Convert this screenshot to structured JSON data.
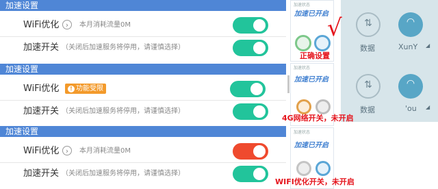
{
  "sections": [
    {
      "header": "加速设置",
      "wifi_label": "WiFi优化",
      "wifi_sub": "本月消耗流量0M",
      "accel_label": "加速开关",
      "accel_sub": "（关闭后加速服务将停用，请谨慎选择）"
    },
    {
      "header": "加速设置",
      "wifi_label": "WiFi优化",
      "wifi_badge": "功能受限",
      "accel_label": "加速开关",
      "accel_sub": "（关闭后加速服务将停用，请谨慎选择）"
    },
    {
      "header": "加速设置",
      "wifi_label": "WiFi优化",
      "wifi_sub": "本月消耗流量0M",
      "accel_label": "加速开关",
      "accel_sub": "（关闭后加速服务将停用，请谨慎选择）"
    }
  ],
  "toggles": {
    "s1_wifi": "on",
    "s1_accel": "on",
    "s2_wifi": "on",
    "s2_accel": "on",
    "s3_wifi": "off",
    "s3_accel": "on"
  },
  "panels": {
    "title": "加速状态",
    "logo": "加速已开启"
  },
  "annotations": {
    "check": "√",
    "correct": "正确设置",
    "g4_off": "4G网络开关，未开启",
    "wifi_off": "WIFI优化开关，未开启"
  },
  "quick_settings": {
    "data_label": "数据",
    "wifi_label_top": "XunY",
    "wifi_label_bottom": "'ou"
  },
  "colors": {
    "accent": "#4f86d6",
    "toggle_on": "#22c49b",
    "toggle_off": "#ef4a2e",
    "annotation": "#e5141c"
  }
}
